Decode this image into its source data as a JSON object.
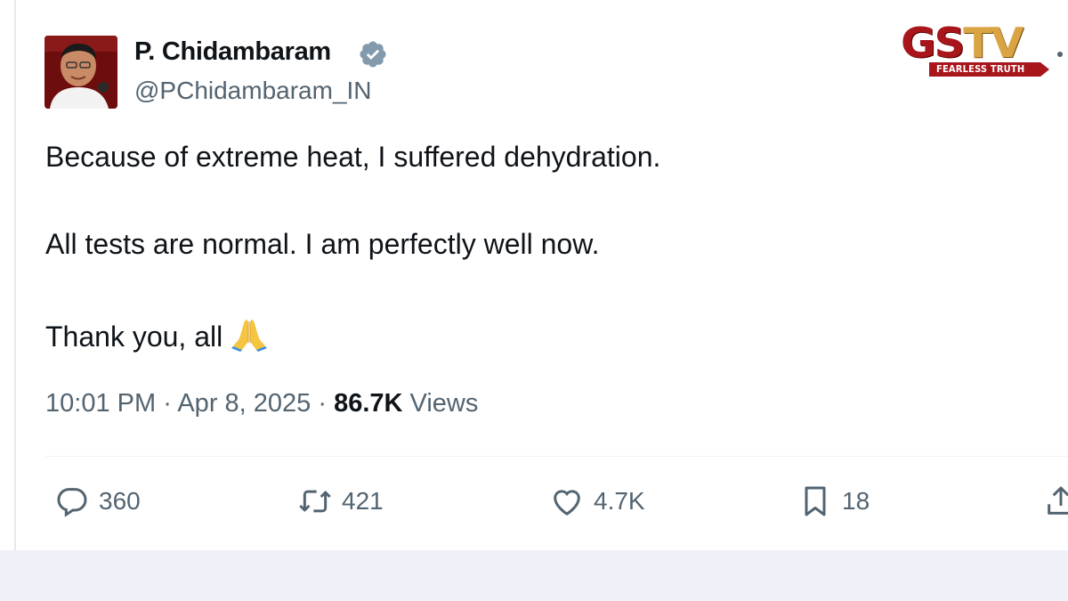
{
  "author": {
    "name": "P. Chidambaram",
    "handle": "@PChidambaram_IN",
    "verified": true
  },
  "tweet": {
    "lines": [
      "Because of extreme heat,  I suffered dehydration.",
      "All tests are normal. I am perfectly well now.",
      "Thank you, all"
    ],
    "emoji": "folded-hands-icon"
  },
  "meta": {
    "time": "10:01 PM",
    "separator": "·",
    "date": "Apr 8, 2025",
    "views_count": "86.7K",
    "views_label": "Views"
  },
  "actions": {
    "replies": "360",
    "reposts": "421",
    "likes": "4.7K",
    "bookmarks": "18"
  },
  "watermark": {
    "main_left": "GS",
    "main_right": "TV",
    "tagline": "FEARLESS TRUTH"
  },
  "colors": {
    "text": "#0f1419",
    "secondary": "#536471",
    "verified_badge": "#829aab",
    "logo_red": "#a8151b",
    "logo_gold": "#d9a441",
    "bottom_band": "#eef1f8"
  }
}
